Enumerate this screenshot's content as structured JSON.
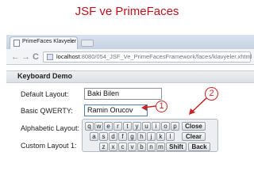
{
  "slide_title": "JSF ve PrimeFaces",
  "browser": {
    "tab_title": "PrimeFaces Klavyeler",
    "tab_close": "×",
    "back_glyph": "←",
    "forward_glyph": "→",
    "reload_glyph": "C",
    "url_host": "localhost",
    "url_path": ":8080/054_JSF_Ve_PrimeFacesFramework/faces/klavyeler.xhtml"
  },
  "panel": {
    "title": "Keyboard Demo",
    "rows": [
      {
        "label": "Default Layout:",
        "value": "Baki Bilen"
      },
      {
        "label": "Basic QWERTY:",
        "value": "Ramin Orucov"
      },
      {
        "label": "Alphabetic Layout:",
        "value": ""
      },
      {
        "label": "Custom Layout 1:",
        "value": ""
      }
    ]
  },
  "keyboard": {
    "row1": [
      "q",
      "w",
      "e",
      "r",
      "t",
      "y",
      "u",
      "i",
      "o",
      "p"
    ],
    "row2": [
      "a",
      "s",
      "d",
      "f",
      "g",
      "h",
      "j",
      "k",
      "l"
    ],
    "row3": [
      "z",
      "x",
      "c",
      "v",
      "b",
      "n",
      "m"
    ],
    "close": "Close",
    "clear": "Clear",
    "shift": "Shift",
    "back": "Back"
  },
  "callouts": {
    "one": "1",
    "two": "2"
  },
  "colors": {
    "title": "#c0101a",
    "callout": "#cc2222"
  }
}
